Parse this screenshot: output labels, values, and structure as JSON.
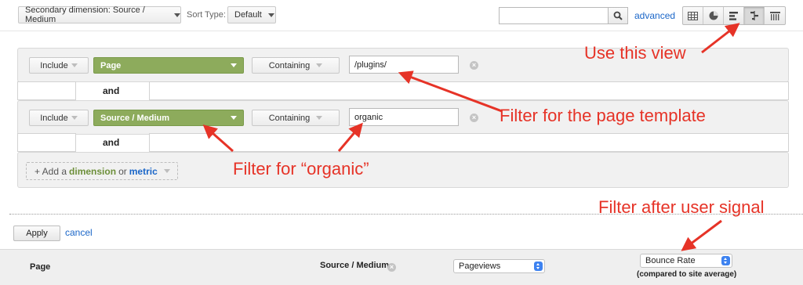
{
  "toolbar": {
    "secondary_dimension": "Secondary dimension: Source / Medium",
    "sort_type_label": "Sort Type:",
    "sort_type_value": "Default",
    "search_value": "",
    "advanced_link": "advanced",
    "view_icons": [
      "data-table-icon",
      "pie-chart-icon",
      "performance-icon",
      "comparison-icon",
      "pivot-icon"
    ]
  },
  "filter_rows": [
    {
      "include": "Include",
      "dimension": "Page",
      "match_type": "Containing",
      "value": "/plugins/"
    },
    {
      "include": "Include",
      "dimension": "Source / Medium",
      "match_type": "Containing",
      "value": "organic"
    }
  ],
  "and_label": "and",
  "add_dimension": {
    "prefix": "+ Add a",
    "dimension": "dimension",
    "or": "or",
    "metric": "metric"
  },
  "actions": {
    "apply": "Apply",
    "cancel": "cancel"
  },
  "table_header": {
    "col_page": "Page",
    "col_source_medium": "Source / Medium",
    "metric_select": "Pageviews",
    "compare_select": "Bounce Rate",
    "compare_note": "(compared to site average)"
  },
  "annotations": {
    "use_view": "Use this view",
    "filter_template": "Filter for the page template",
    "filter_organic": "Filter for “organic”",
    "filter_signal": "Filter after user signal"
  },
  "colors": {
    "annotation": "#e63327",
    "dimension_green": "#8dab5c",
    "link_blue": "#1a66c8"
  }
}
